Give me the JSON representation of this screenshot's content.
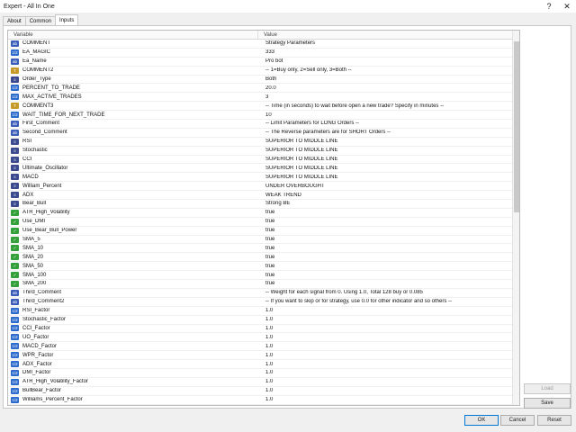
{
  "window": {
    "title": "Expert - All In One",
    "help_glyph": "?",
    "close_glyph": "✕"
  },
  "tabs": [
    {
      "label": "About",
      "active": false
    },
    {
      "label": "Common",
      "active": false
    },
    {
      "label": "Inputs",
      "active": true
    }
  ],
  "grid": {
    "headers": {
      "variable": "Variable",
      "value": "Value"
    },
    "rows": [
      {
        "icon": "ab",
        "name": "COMMENT",
        "value": "Strategy Parameters"
      },
      {
        "icon": "va",
        "name": "EA_MAGIC",
        "value": "333"
      },
      {
        "icon": "ab",
        "name": "Ea_Name",
        "value": "Pro bot"
      },
      {
        "icon": "tx",
        "name": "COMMENT2",
        "value": "-- 1=Buy only, 2=Sell only, 3=Both --"
      },
      {
        "icon": "en",
        "name": "Order_Type",
        "value": "Both"
      },
      {
        "icon": "va",
        "name": "PERCENT_TO_TRADE",
        "value": "20.0"
      },
      {
        "icon": "va",
        "name": "MAX_ACTIVE_TRADES",
        "value": "3"
      },
      {
        "icon": "tx",
        "name": "COMMENT3",
        "value": "-- Time (in seconds) to wait before open a new trade? Specify in minutes --"
      },
      {
        "icon": "va",
        "name": "WAIT_TIME_FOR_NEXT_TRADE",
        "value": "10"
      },
      {
        "icon": "ab",
        "name": "First_Comment",
        "value": "-- Limit Parameters for LONG Orders --"
      },
      {
        "icon": "ab",
        "name": "Second_Comment",
        "value": "-- The Reverse parameters are for SHORT Orders --"
      },
      {
        "icon": "en",
        "name": "RSI",
        "value": "SUPERIOR TO MIDDLE LINE"
      },
      {
        "icon": "en",
        "name": "Stochastic",
        "value": "SUPERIOR TO MIDDLE LINE"
      },
      {
        "icon": "en",
        "name": "CCI",
        "value": "SUPERIOR TO MIDDLE LINE"
      },
      {
        "icon": "en",
        "name": "Ultimate_Oscillator",
        "value": "SUPERIOR TO MIDDLE LINE"
      },
      {
        "icon": "en",
        "name": "MACD",
        "value": "SUPERIOR TO MIDDLE LINE"
      },
      {
        "icon": "en",
        "name": "William_Percent",
        "value": "UNDER OVERBOUGHT"
      },
      {
        "icon": "en",
        "name": "ADX",
        "value": "WEAK TREND"
      },
      {
        "icon": "en",
        "name": "Bear_Bull",
        "value": "Strong BE"
      },
      {
        "icon": "bo",
        "name": "ATR_High_Volatility",
        "value": "true"
      },
      {
        "icon": "bo",
        "name": "Use_DMI",
        "value": "true"
      },
      {
        "icon": "bo",
        "name": "Use_Bear_Bull_Power",
        "value": "true"
      },
      {
        "icon": "bo",
        "name": "SMA_5",
        "value": "true"
      },
      {
        "icon": "bo",
        "name": "SMA_10",
        "value": "true"
      },
      {
        "icon": "bo",
        "name": "SMA_20",
        "value": "true"
      },
      {
        "icon": "bo",
        "name": "SMA_50",
        "value": "true"
      },
      {
        "icon": "bo",
        "name": "SMA_100",
        "value": "true"
      },
      {
        "icon": "bo",
        "name": "SMA_200",
        "value": "true"
      },
      {
        "icon": "ab",
        "name": "Third_Comment",
        "value": "-- Weight for each signal from 0. Using 1.0, Total 128 buy or 0.085"
      },
      {
        "icon": "ab",
        "name": "Third_Comment2",
        "value": "-- If you want to skip or for strategy, use 0.0 for other indicator and so others --"
      },
      {
        "icon": "va",
        "name": "RSI_Factor",
        "value": "1.0"
      },
      {
        "icon": "va",
        "name": "Stochastic_Factor",
        "value": "1.0"
      },
      {
        "icon": "va",
        "name": "CCI_Factor",
        "value": "1.0"
      },
      {
        "icon": "va",
        "name": "UO_Factor",
        "value": "1.0"
      },
      {
        "icon": "va",
        "name": "MACD_Factor",
        "value": "1.0"
      },
      {
        "icon": "va",
        "name": "WPR_Factor",
        "value": "1.0"
      },
      {
        "icon": "va",
        "name": "ADX_Factor",
        "value": "1.0"
      },
      {
        "icon": "va",
        "name": "DMI_Factor",
        "value": "1.0"
      },
      {
        "icon": "va",
        "name": "ATR_High_Volatility_Factor",
        "value": "1.0"
      },
      {
        "icon": "va",
        "name": "BullBear_Factor",
        "value": "1.0"
      },
      {
        "icon": "va",
        "name": "Williams_Percent_Factor",
        "value": "1.0"
      }
    ]
  },
  "side_buttons": {
    "load": "Load",
    "save": "Save"
  },
  "footer_buttons": {
    "ok": "OK",
    "cancel": "Cancel",
    "reset": "Reset"
  }
}
